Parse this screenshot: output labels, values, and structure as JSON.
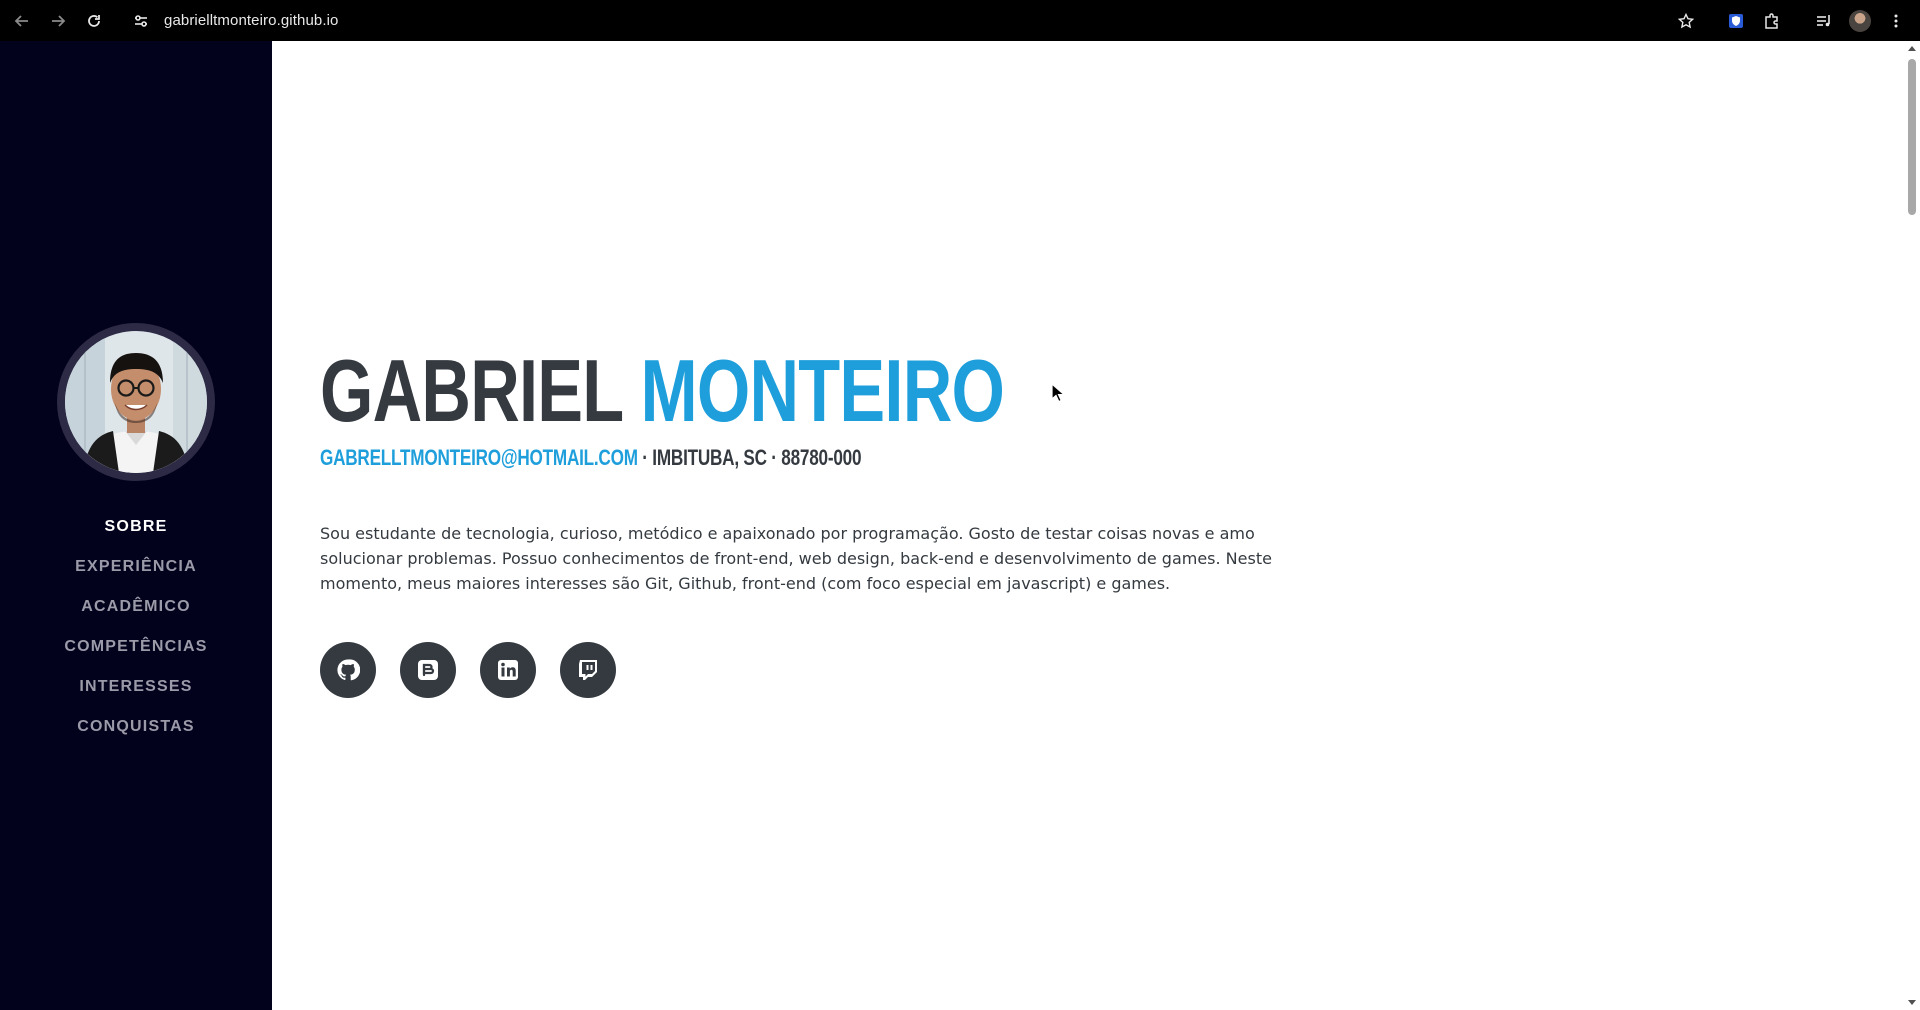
{
  "browser": {
    "url": "gabrielltmonteiro.github.io",
    "icons": {
      "back": "arrow-left-icon",
      "forward": "arrow-right-icon",
      "reload": "reload-icon",
      "site_info": "tune-icon",
      "bookmark": "star-icon",
      "extension": "shield-extension-icon",
      "extensions_menu": "puzzle-icon",
      "media": "media-control-icon",
      "profile": "profile-avatar",
      "menu": "kebab-menu-icon"
    }
  },
  "sidebar": {
    "background": "#03021d",
    "nav": [
      {
        "label": "SOBRE",
        "active": true
      },
      {
        "label": "EXPERIÊNCIA",
        "active": false
      },
      {
        "label": "ACADÊMICO",
        "active": false
      },
      {
        "label": "COMPETÊNCIAS",
        "active": false
      },
      {
        "label": "INTERESSES",
        "active": false
      },
      {
        "label": "CONQUISTAS",
        "active": false
      }
    ]
  },
  "main": {
    "first_name": "GABRIEL",
    "last_name": "MONTEIRO",
    "email": "GABRELLTMONTEIRO@HOTMAIL.COM",
    "location": " · IMBITUBA, SC · 88780-000",
    "about": "Sou estudante de tecnologia, curioso, metódico e apaixonado por programação. Gosto de testar coisas novas e amo solucionar problemas. Possuo conhecimentos de front-end, web design, back-end e desenvolvimento de games. Neste momento, meus maiores interesses são Git, Github, front-end (com foco especial em javascript) e games.",
    "social": [
      {
        "icon": "github-icon"
      },
      {
        "icon": "blogger-icon"
      },
      {
        "icon": "linkedin-icon"
      },
      {
        "icon": "twitch-icon"
      }
    ]
  },
  "colors": {
    "accent": "#1e9fdc",
    "heading": "#343a40",
    "sidebar_bg": "#03021d"
  }
}
